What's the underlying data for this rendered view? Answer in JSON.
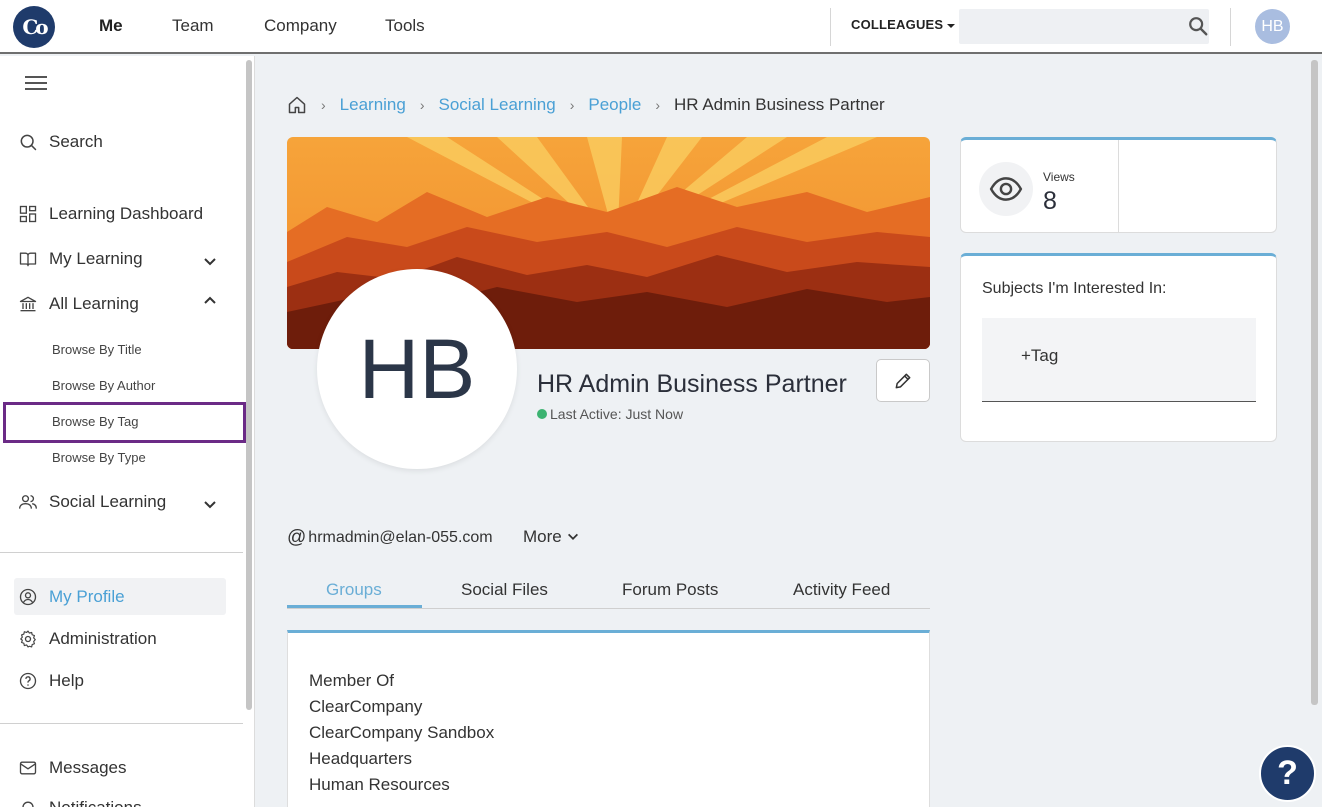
{
  "brand": {
    "logo_text": "Co"
  },
  "topnav": {
    "items": [
      "Me",
      "Team",
      "Company",
      "Tools"
    ],
    "colleagues_label": "COLLEAGUES",
    "search_placeholder": "",
    "avatar_initials": "HB"
  },
  "sidebar": {
    "search_label": "Search",
    "items": {
      "learning_dashboard": "Learning Dashboard",
      "my_learning": "My Learning",
      "all_learning": "All Learning",
      "social_learning": "Social Learning",
      "my_profile": "My Profile",
      "administration": "Administration",
      "help": "Help",
      "messages": "Messages",
      "notifications": "Notifications"
    },
    "all_learning_sub": [
      "Browse By Title",
      "Browse By Author",
      "Browse By Tag",
      "Browse By Type"
    ]
  },
  "breadcrumb": {
    "links": [
      "Learning",
      "Social Learning",
      "People"
    ],
    "current": "HR Admin Business Partner"
  },
  "profile": {
    "initials": "HB",
    "name": "HR Admin Business Partner",
    "last_active": "Last Active: Just Now",
    "email": "hrmadmin@elan-055.com",
    "more_label": "More"
  },
  "tabs": [
    "Groups",
    "Social Files",
    "Forum Posts",
    "Activity Feed"
  ],
  "groups_panel": {
    "heading": "Member Of",
    "groups": [
      "ClearCompany",
      "ClearCompany Sandbox",
      "Headquarters",
      "Human Resources"
    ]
  },
  "stats": {
    "views_label": "Views",
    "views_value": "8"
  },
  "interests": {
    "title": "Subjects I'm Interested In:",
    "add_tag_label": "+Tag"
  },
  "help_fab": "?",
  "colors": {
    "accent": "#4aa0d5",
    "brand_navy": "#1f3b6b",
    "highlight": "#6b2a86",
    "online": "#3cb371"
  }
}
